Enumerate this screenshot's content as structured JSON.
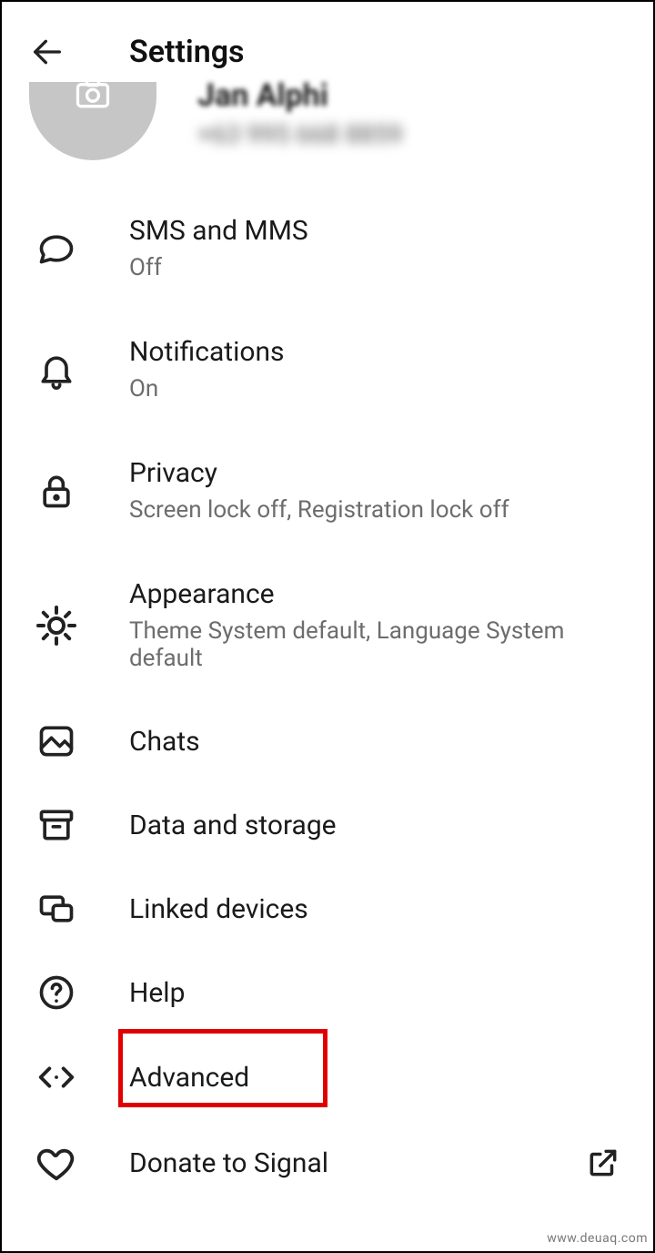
{
  "header": {
    "title": "Settings"
  },
  "profile": {
    "name": "Jan Alphi",
    "phone": "+63 995 668 8859"
  },
  "items": {
    "sms": {
      "title": "SMS and MMS",
      "sub": "Off"
    },
    "notif": {
      "title": "Notifications",
      "sub": "On"
    },
    "privacy": {
      "title": "Privacy",
      "sub": "Screen lock off, Registration lock off"
    },
    "appearance": {
      "title": "Appearance",
      "sub": "Theme System default, Language System default"
    },
    "chats": {
      "title": "Chats"
    },
    "data": {
      "title": "Data and storage"
    },
    "linked": {
      "title": "Linked devices"
    },
    "help": {
      "title": "Help"
    },
    "advanced": {
      "title": "Advanced"
    },
    "donate": {
      "title": "Donate to Signal"
    }
  },
  "watermark": "www.deuaq.com"
}
